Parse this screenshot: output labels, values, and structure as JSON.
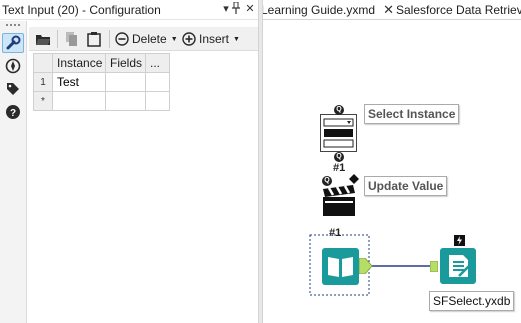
{
  "config_panel": {
    "title": "Text Input (20) - Configuration",
    "title_controls": {
      "dropdown": "▾",
      "pin": "📌",
      "close": "✕"
    },
    "toolbar": {
      "delete_label": "Delete",
      "insert_label": "Insert"
    },
    "side_tools": [
      "wrench-icon",
      "compass-icon",
      "tag-icon",
      "help-icon"
    ],
    "grid": {
      "headers": [
        "Instance",
        "Fields",
        "..."
      ],
      "rows": [
        {
          "num": "1",
          "cells": [
            "Test",
            "",
            ""
          ]
        },
        {
          "num": "*",
          "cells": [
            "",
            "",
            ""
          ]
        }
      ]
    }
  },
  "tabs": [
    {
      "label": "Learning Guide.yxmd",
      "close": "✕"
    },
    {
      "label": "Salesforce Data Retrieve",
      "close": ""
    }
  ],
  "canvas": {
    "select_instance_label": "Select Instance",
    "update_value_label": "Update Value",
    "hash_label": "#1",
    "hash_label_2": "#1",
    "output_label": "SFSelect.yxdb",
    "colors": {
      "teal": "#1a9a9a",
      "anchor_green": "#b6de66",
      "connector": "#2a3c8c"
    }
  }
}
